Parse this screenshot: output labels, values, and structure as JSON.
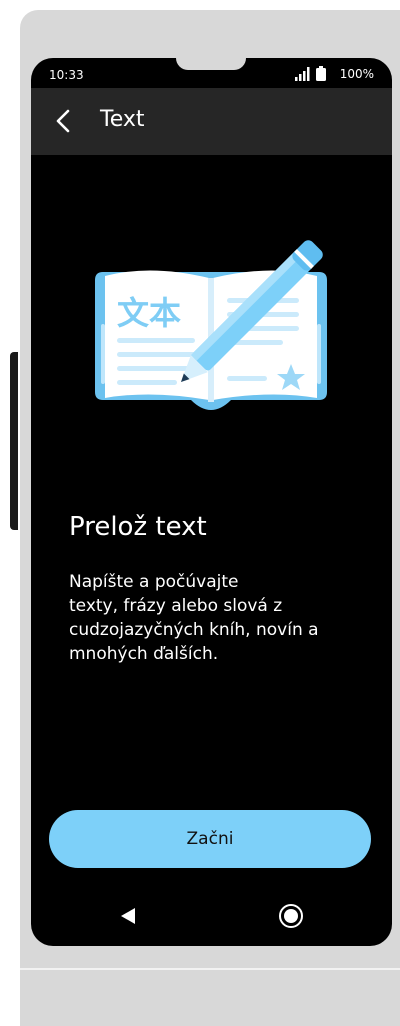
{
  "status_bar": {
    "time": "10:33",
    "battery": "100%"
  },
  "app_bar": {
    "title": "Text"
  },
  "illustration": {
    "book_chars": "文本"
  },
  "content": {
    "headline": "Prelož text",
    "body_lines": [
      "Napíšte a počúvajte",
      "texty, frázy alebo slová z",
      "cudzojazyčných kníh, novín a",
      "mnohých ďalších."
    ]
  },
  "actions": {
    "start_label": "Začni"
  },
  "colors": {
    "accent": "#7dd0f9",
    "app_bar": "#262626",
    "screen_bg": "#000000"
  }
}
